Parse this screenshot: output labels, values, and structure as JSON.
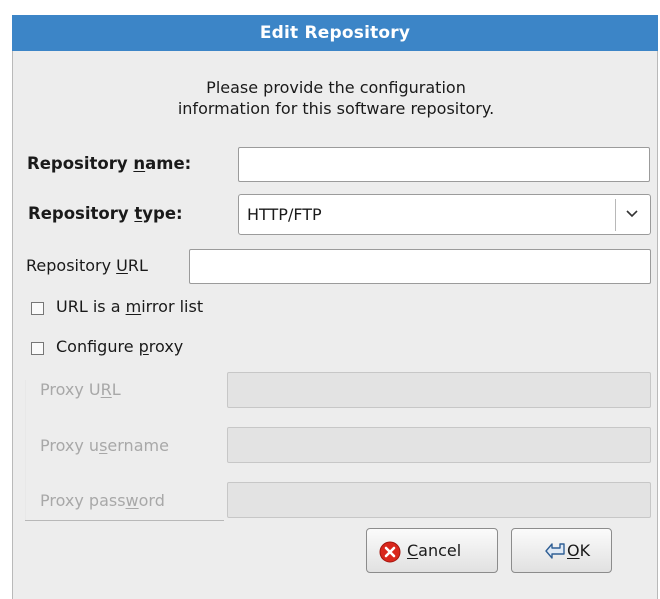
{
  "dialog": {
    "title": "Edit Repository",
    "intro_line1": "Please provide the configuration",
    "intro_line2": "information for this software repository."
  },
  "form": {
    "name_label_pre": "Repository ",
    "name_label_mn": "n",
    "name_label_post": "ame:",
    "name_value": "",
    "type_label_pre": "Repository ",
    "type_label_mn": "t",
    "type_label_post": "ype:",
    "type_selected": "HTTP/FTP",
    "url_label_pre": "Repository ",
    "url_label_mn": "U",
    "url_label_post": "RL",
    "url_value": "",
    "mirror_pre": "URL is a ",
    "mirror_mn": "m",
    "mirror_post": "irror list",
    "mirror_checked": false,
    "proxy_pre": "Configure ",
    "proxy_mn": "p",
    "proxy_post": "roxy",
    "proxy_checked": false
  },
  "proxy": {
    "url_pre": "Proxy U",
    "url_mn": "R",
    "url_post": "L",
    "url_value": "",
    "user_pre": "Proxy u",
    "user_mn": "s",
    "user_post": "ername",
    "user_value": "",
    "pass_pre": "Proxy pass",
    "pass_mn": "w",
    "pass_post": "ord",
    "pass_value": ""
  },
  "buttons": {
    "cancel_mn": "C",
    "cancel_rest": "ancel",
    "ok_mn": "O",
    "ok_rest": "K"
  },
  "icons": {
    "combo_arrow": "chevron-down-icon",
    "cancel": "cancel-icon",
    "ok": "ok-return-icon"
  },
  "colors": {
    "titlebar": "#3c85c7",
    "cancel_icon": "#d9271c"
  }
}
